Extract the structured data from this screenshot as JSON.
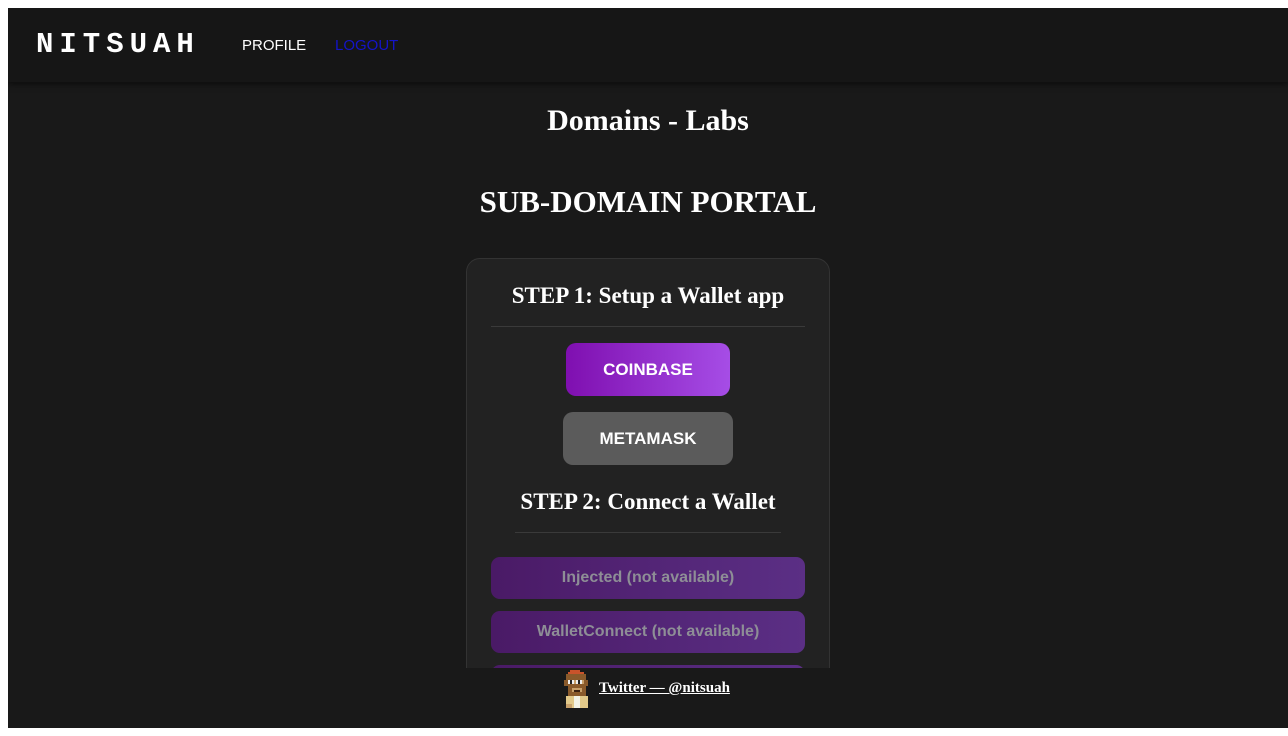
{
  "navbar": {
    "brand": "NITSUAH",
    "links": [
      {
        "label": "PROFILE"
      },
      {
        "label": "LOGOUT"
      }
    ]
  },
  "page": {
    "site_title": "Domains - Labs",
    "portal_title": "SUB-DOMAIN PORTAL"
  },
  "card": {
    "step1_title": "STEP 1: Setup a Wallet app",
    "wallet_apps": [
      {
        "label": "COINBASE"
      },
      {
        "label": "METAMASK"
      }
    ],
    "step2_title": "STEP 2: Connect a Wallet",
    "connectors": [
      {
        "label": "Injected (not available)"
      },
      {
        "label": "WalletConnect (not available)"
      }
    ]
  },
  "footer": {
    "link_text": "Twitter — @nitsuah",
    "avatar_icon": "pixel-ape-avatar-icon"
  },
  "colors": {
    "background": "#191919",
    "navbar": "#161616",
    "card": "#222222",
    "accent_purple": "#a64de6",
    "logout_link": "#1414c8",
    "metamask_button": "#5b5b5b"
  }
}
